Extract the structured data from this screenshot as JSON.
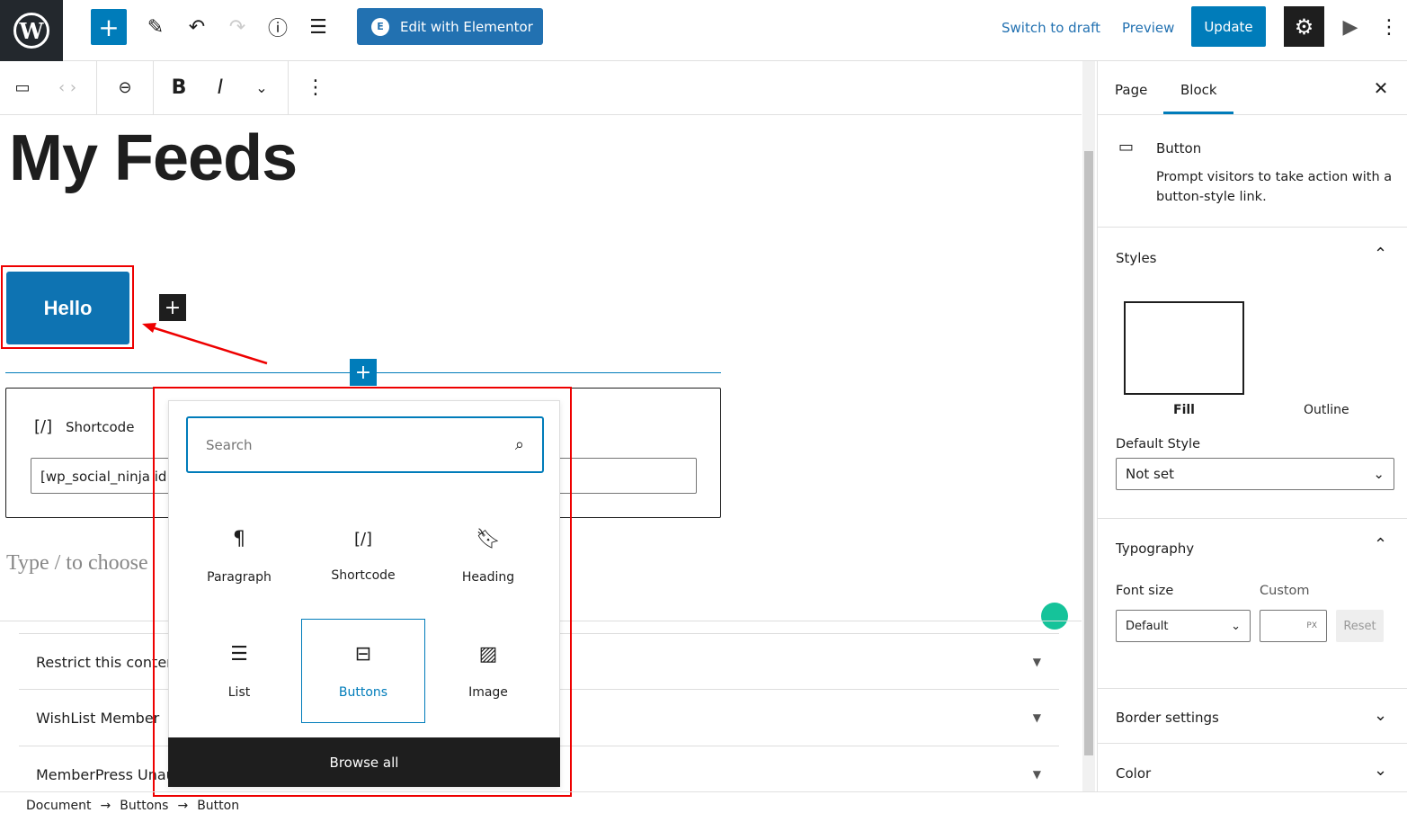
{
  "topbar": {
    "edit_elementor": "Edit with Elementor",
    "switch_draft": "Switch to draft",
    "preview": "Preview",
    "update": "Update"
  },
  "editor": {
    "title": "My Feeds",
    "button_text": "Hello",
    "shortcode_label": "Shortcode",
    "shortcode_value": "[wp_social_ninja id=",
    "placeholder": "Type / to choose"
  },
  "inserter": {
    "search_placeholder": "Search",
    "items": [
      {
        "label": "Paragraph",
        "icon": "¶"
      },
      {
        "label": "Shortcode",
        "icon": "[/]"
      },
      {
        "label": "Heading",
        "icon": "bookmark"
      },
      {
        "label": "List",
        "icon": "list"
      },
      {
        "label": "Buttons",
        "icon": "buttons"
      },
      {
        "label": "Image",
        "icon": "image"
      }
    ],
    "browse_all": "Browse all"
  },
  "metaboxes": [
    "Restrict this content",
    "WishList Member",
    "MemberPress Unauthorized Access"
  ],
  "breadcrumb": [
    "Document",
    "Buttons",
    "Button"
  ],
  "sidebar": {
    "tabs": [
      "Page",
      "Block"
    ],
    "active_tab": "Block",
    "block_name": "Button",
    "block_desc": "Prompt visitors to take action with a button-style link.",
    "styles": "Styles",
    "fill": "Fill",
    "outline": "Outline",
    "default_style_label": "Default Style",
    "default_style_value": "Not set",
    "typography": "Typography",
    "font_size_label": "Font size",
    "custom_label": "Custom",
    "font_size_value": "Default",
    "unit": "PX",
    "reset": "Reset",
    "border_settings": "Border settings",
    "color": "Color"
  },
  "colors": {
    "accent": "#007cba",
    "annotation": "#e00000"
  }
}
